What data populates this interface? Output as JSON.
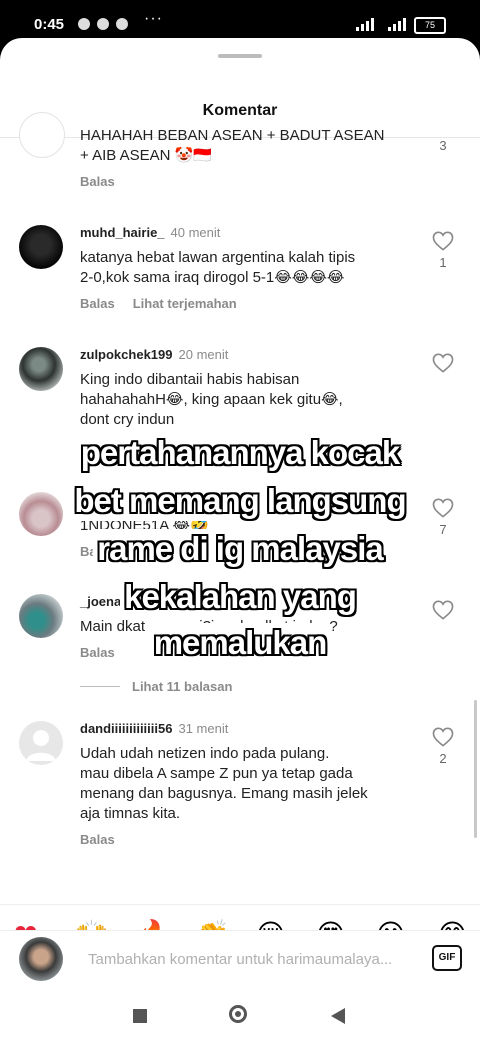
{
  "status": {
    "time": "0:45",
    "more": "···",
    "battery": "75"
  },
  "sheet": {
    "title": "Komentar"
  },
  "comments": [
    {
      "text": "HAHAHAH BEBAN ASEAN + BADUT ASEAN\n+ AIB ASEAN 🤡🇮🇩",
      "reply": "Balas",
      "likes": "3"
    },
    {
      "user": "muhd_hairie_",
      "time": "40 menit",
      "text": "katanya hebat lawan argentina kalah tipis\n2-0,kok sama iraq dirogol 5-1😂😂😂😂",
      "reply": "Balas",
      "translate": "Lihat terjemahan",
      "likes": "1"
    },
    {
      "user": "zulpokchek199",
      "time": "20 menit",
      "text": "King indo dibantaii habis habisan\nhahahahahH😂, king apaan kek gitu😂,\ndont cry indun",
      "reply": "Balas",
      "likes": ""
    },
    {
      "user": "",
      "time": "",
      "text": "1NDONE51A 😂🤣",
      "reply": "Balas",
      "likes": "7"
    },
    {
      "user": "_joena",
      "time": "",
      "text": "Main dkat mana ni?iraq ke dkat indon?",
      "reply": "Balas",
      "likes": ""
    },
    {
      "user": "dandiiiiiiiiiiiii56",
      "time": "31 menit",
      "text": "Udah udah netizen indo pada pulang.\nmau dibela A sampe Z pun ya tetap gada\nmenang dan bagusnya. Emang masih jelek\naja timnas kita.",
      "reply": "Balas",
      "likes": "2"
    }
  ],
  "view_replies": "Lihat 11 balasan",
  "overlay_lines": [
    "pertahanannya kocak",
    "bet memang langsung",
    "rame di ig malaysia",
    "kekalahan yang",
    "memalukan"
  ],
  "emoji_bar": [
    "❤",
    "🙌",
    "🔥",
    "👏",
    "😢",
    "😍",
    "😮",
    "😂"
  ],
  "input": {
    "placeholder": "Tambahkan komentar untuk harimaumalaya...",
    "gif_label": "GIF"
  },
  "colors": {
    "heart": "#e8253b",
    "overlay_text": "#ffffff",
    "overlay_outline": "#000000"
  }
}
